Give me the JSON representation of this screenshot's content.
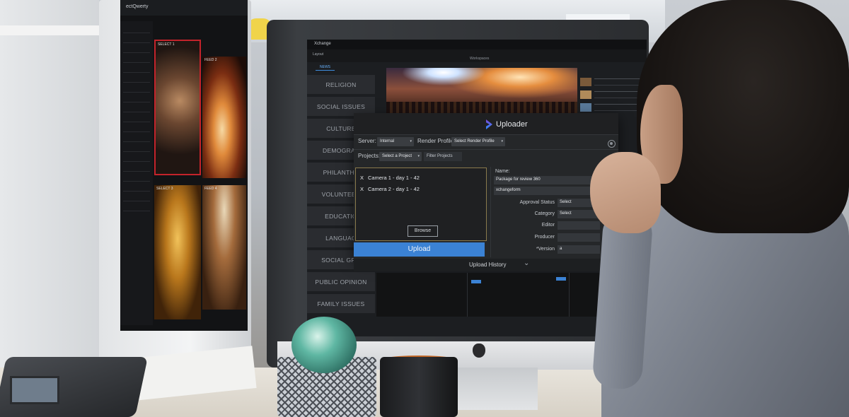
{
  "left_monitor": {
    "app_brand": "ectQwerty",
    "tiles": [
      {
        "tag": "SELECT 1"
      },
      {
        "tag": "FEED 2"
      },
      {
        "tag": "SELECT 3"
      },
      {
        "tag": "FEED 4"
      }
    ]
  },
  "main_app": {
    "app_name": "Xchange",
    "workspace_label": "Workspaces",
    "tab_layout": "Layout",
    "tab_news": "NEWS",
    "categories": [
      "RELIGION",
      "SOCIAL ISSUES",
      "CULTURE",
      "DEMOGRAP",
      "PHILANTHR",
      "VOLUNTEER",
      "EDUCATIO",
      "LANGUAG",
      "SOCIAL GRO",
      "PUBLIC OPINION",
      "FAMILY ISSUES"
    ]
  },
  "uploader": {
    "title": "Uploader",
    "server_label": "Server:",
    "server_value": "Internal",
    "render_profile_label": "Render Profile:",
    "render_profile_value": "Select Render Profile",
    "projects_label": "Projects:",
    "projects_value": "Select a Project",
    "filter_placeholder": "Filter Projects",
    "files": [
      {
        "remove": "X",
        "name": "Camera 1 - day 1 - 42"
      },
      {
        "remove": "X",
        "name": "Camera 2 - day 1 - 42"
      }
    ],
    "browse_label": "Browse",
    "upload_label": "Upload",
    "name_label": "Name:",
    "name_value": "Package for review 360",
    "project_value": "xchangeform",
    "fields": [
      {
        "label": "Approval Status",
        "value": "Select"
      },
      {
        "label": "Category",
        "value": "Select"
      },
      {
        "label": "Editor",
        "value": ""
      },
      {
        "label": "Producer",
        "value": ""
      },
      {
        "label": "*Version",
        "value": "a"
      }
    ],
    "history_label": "Upload History"
  },
  "colors": {
    "accent_blue": "#3b82d4",
    "selection_red": "#c3232b",
    "ui_dark": "#1c1e21"
  }
}
